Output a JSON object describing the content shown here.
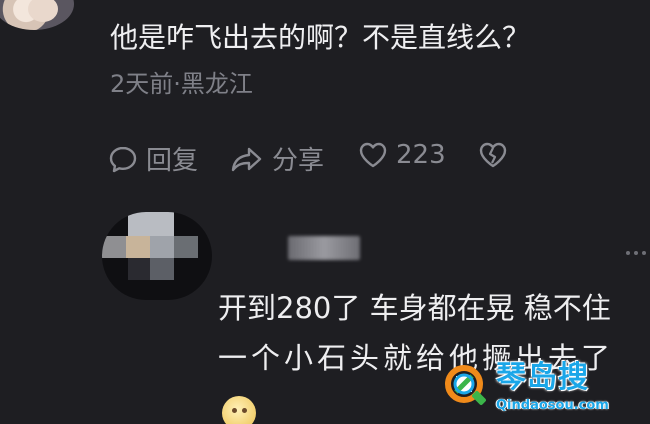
{
  "comment": {
    "text": "他是咋飞出去的啊？不是直线么？",
    "meta": "2天前·黑龙江",
    "actions": {
      "reply_label": "回复",
      "share_label": "分享",
      "like_count": "223"
    }
  },
  "reply": {
    "line1": "开到280了 车身都在晃 稳不住",
    "line2": "一个小石头就给他撅出去了"
  },
  "watermark": {
    "title": "琴岛搜",
    "url": "Qindaosou.com"
  },
  "colors": {
    "background": "#1e1e22",
    "text": "#efeff1",
    "muted": "#7f8088",
    "watermark": "#1aa6e8"
  },
  "icons": [
    "reply-bubble-icon",
    "share-arrow-icon",
    "heart-icon",
    "broken-heart-icon",
    "more-icon",
    "emoji-icon",
    "watermark-logo-icon"
  ]
}
